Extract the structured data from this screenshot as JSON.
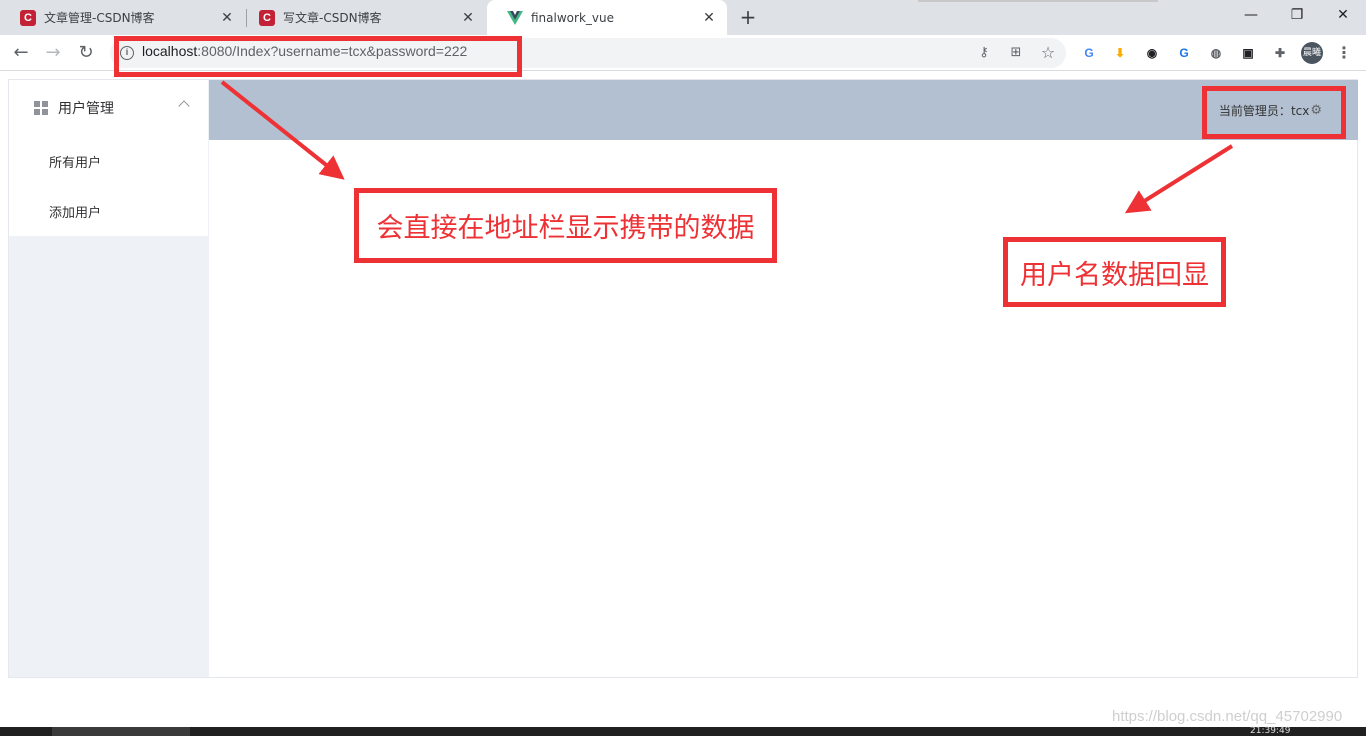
{
  "browser": {
    "tabs": [
      {
        "title": "文章管理-CSDN博客",
        "favicon": "csdn-icon",
        "active": false
      },
      {
        "title": "写文章-CSDN博客",
        "favicon": "csdn-icon",
        "active": false
      },
      {
        "title": "finalwork_vue",
        "favicon": "vue-icon",
        "active": true
      }
    ],
    "favicon_letter": "C",
    "close_glyph": "✕",
    "new_tab_glyph": "+",
    "window_controls": {
      "minimize": "—",
      "restore": "❐",
      "close": "✕"
    },
    "nav": {
      "back": "←",
      "forward": "→",
      "reload": "↻"
    },
    "address": {
      "host": "localhost",
      "rest": ":8080/Index?username=tcx&password=222"
    },
    "info_glyph": "i",
    "omnibox_icons": {
      "key": "⚷",
      "translate": "⊞",
      "star": "☆"
    },
    "extensions": [
      {
        "name": "g-ext-icon",
        "glyph": "G",
        "color": "#4285f4"
      },
      {
        "name": "download-ext-icon",
        "glyph": "⬇",
        "color": "#f9ab00"
      },
      {
        "name": "tampermonkey-icon",
        "glyph": "◉",
        "color": "#202124"
      },
      {
        "name": "translate-ext-icon",
        "glyph": "G",
        "color": "#1a73e8"
      },
      {
        "name": "bulb-ext-icon",
        "glyph": "◍",
        "color": "#5f6368"
      },
      {
        "name": "terminal-ext-icon",
        "glyph": "▣",
        "color": "#202124"
      },
      {
        "name": "puzzle-icon",
        "glyph": "✚",
        "color": "#5f6368"
      }
    ],
    "profile_label": "晨曦",
    "menu_glyph": "⋮"
  },
  "app": {
    "sidebar": {
      "group_title": "用户管理",
      "items": [
        "所有用户",
        "添加用户"
      ]
    },
    "header": {
      "admin_label": "当前管理员：",
      "admin_name": "tcx",
      "gear_glyph": "⚙"
    }
  },
  "annotations": {
    "url_note": "会直接在地址栏显示携带的数据",
    "user_note": "用户名数据回显",
    "color": "#ee3135"
  },
  "watermark": "https://blog.csdn.net/qq_45702990",
  "taskbar_clock": "21:39:49"
}
